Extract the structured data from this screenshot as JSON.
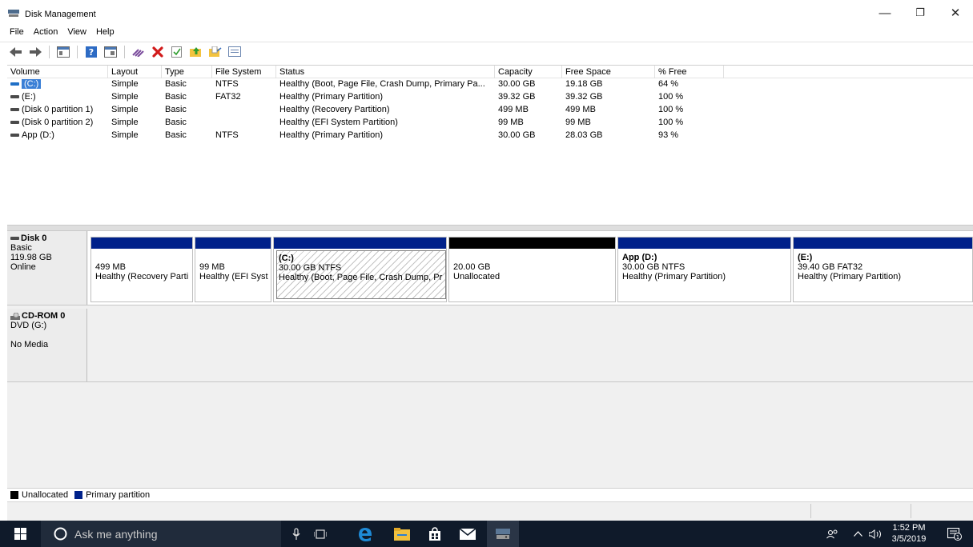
{
  "window": {
    "title": "Disk Management",
    "minimize_glyph": "—",
    "restore_glyph": "❐",
    "close_glyph": "✕"
  },
  "menu": [
    "File",
    "Action",
    "View",
    "Help"
  ],
  "toolbar_icons": [
    "back-arrow-icon",
    "forward-arrow-icon",
    "console-tree-icon",
    "help-icon",
    "list-view-icon",
    "connect-icon",
    "delete-icon",
    "check-icon",
    "folder-up-icon",
    "open-folder-icon",
    "properties-icon"
  ],
  "volume_list": {
    "columns": [
      "Volume",
      "Layout",
      "Type",
      "File System",
      "Status",
      "Capacity",
      "Free Space",
      "% Free"
    ],
    "rows": [
      {
        "volume": "(C:)",
        "layout": "Simple",
        "type": "Basic",
        "fs": "NTFS",
        "status": "Healthy (Boot, Page File, Crash Dump, Primary Pa...",
        "capacity": "30.00 GB",
        "free": "19.18 GB",
        "pct": "64 %"
      },
      {
        "volume": "(E:)",
        "layout": "Simple",
        "type": "Basic",
        "fs": "FAT32",
        "status": "Healthy (Primary Partition)",
        "capacity": "39.32 GB",
        "free": "39.32 GB",
        "pct": "100 %"
      },
      {
        "volume": "(Disk 0 partition 1)",
        "layout": "Simple",
        "type": "Basic",
        "fs": "",
        "status": "Healthy (Recovery Partition)",
        "capacity": "499 MB",
        "free": "499 MB",
        "pct": "100 %"
      },
      {
        "volume": "(Disk 0 partition 2)",
        "layout": "Simple",
        "type": "Basic",
        "fs": "",
        "status": "Healthy (EFI System Partition)",
        "capacity": "99 MB",
        "free": "99 MB",
        "pct": "100 %"
      },
      {
        "volume": "App (D:)",
        "layout": "Simple",
        "type": "Basic",
        "fs": "NTFS",
        "status": "Healthy (Primary Partition)",
        "capacity": "30.00 GB",
        "free": "28.03 GB",
        "pct": "93 %"
      }
    ]
  },
  "disks": [
    {
      "name": "Disk 0",
      "kind": "Basic",
      "size": "119.98 GB",
      "state": "Online",
      "partitions": [
        {
          "label": "",
          "size": "499 MB",
          "status": "Healthy (Recovery Parti"
        },
        {
          "label": "",
          "size": "99 MB",
          "status": "Healthy (EFI Syst"
        },
        {
          "label": "(C:)",
          "size": "30.00 GB NTFS",
          "status": "Healthy (Boot, Page File, Crash Dump, Pr"
        },
        {
          "label": "",
          "size": "20.00 GB",
          "status": "Unallocated"
        },
        {
          "label": "App  (D:)",
          "size": "30.00 GB NTFS",
          "status": "Healthy (Primary Partition)"
        },
        {
          "label": "(E:)",
          "size": "39.40 GB FAT32",
          "status": "Healthy (Primary Partition)"
        }
      ]
    },
    {
      "name": "CD-ROM 0",
      "kind": "DVD (G:)",
      "size": "",
      "state": "No Media"
    }
  ],
  "legend": [
    {
      "label": "Unallocated",
      "color": "#000000"
    },
    {
      "label": "Primary partition",
      "color": "#00218a"
    }
  ],
  "taskbar": {
    "search_placeholder": "Ask me anything",
    "time": "1:52 PM",
    "date": "3/5/2019",
    "pinned": [
      "microphone-icon",
      "task-view-icon",
      "edge-icon",
      "file-explorer-icon",
      "store-icon",
      "mail-icon",
      "disk-management-icon"
    ]
  },
  "colors": {
    "primary_partition": "#00218a",
    "unallocated": "#000000",
    "taskbar": "#0f1a2a",
    "selection": "#3a7fd6"
  }
}
